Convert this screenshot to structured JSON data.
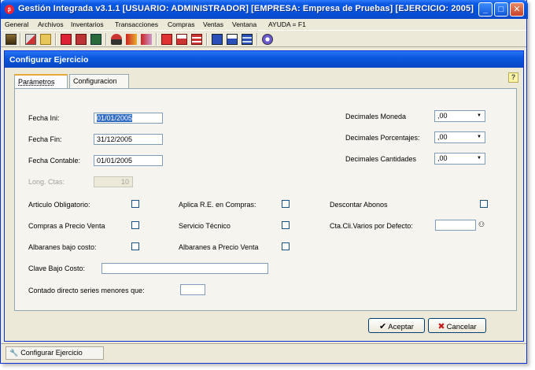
{
  "window": {
    "title": "Gestión Integrada v3.1.1  [USUARIO: ADMINISTRADOR]  [EMPRESA: Empresa de Pruebas]  [EJERCICIO: 2005]",
    "app_icon": "app-logo-icon",
    "min_label": "_",
    "max_label": "□",
    "close_label": "✕"
  },
  "menu": {
    "items": [
      "General",
      "Archivos",
      "Inventarios",
      "Transacciones",
      "Compras",
      "Ventas",
      "Ventana",
      "AYUDA = F1"
    ]
  },
  "toolbar": {
    "icons": [
      "calculator-icon",
      "printer-settings-icon",
      "folder-icon",
      "report-f-icon",
      "report-u-icon",
      "report-b-icon",
      "transfer-icon",
      "payables-icon",
      "receivables-icon",
      "doc-red-icon",
      "doc-open-icon",
      "doc-grid-icon",
      "doc-blue-icon",
      "doc-stack-icon",
      "doc-window-icon",
      "network-icon"
    ]
  },
  "dialog": {
    "title": "Configurar Ejercicio",
    "tabs": [
      "Parámetros",
      "Configuracion"
    ],
    "help_label": "?",
    "fields": {
      "fecha_ini": {
        "label": "Fecha Ini:",
        "value": "01/01/2005"
      },
      "fecha_fin": {
        "label": "Fecha Fin:",
        "value": "31/12/2005"
      },
      "fecha_contable": {
        "label": "Fecha Contable:",
        "value": "01/01/2005"
      },
      "long_ctas": {
        "label": "Long. Ctas:",
        "value": "10"
      },
      "decimales_moneda": {
        "label": "Decimales Moneda",
        "value": ",00"
      },
      "decimales_porcentajes": {
        "label": "Decimales Porcentajes:",
        "value": ",00"
      },
      "decimales_cantidades": {
        "label": "Decimales Cantidades",
        "value": ",00"
      },
      "clave_bajo_costo": {
        "label": "Clave Bajo Costo:",
        "value": ""
      },
      "contado_directo": {
        "label": "Contado directo series menores que:",
        "value": ""
      },
      "cta_cli_varios": {
        "label": "Cta.Cli.Varios por Defecto:",
        "value": ""
      }
    },
    "checkboxes": {
      "articulo_obligatorio": "Articulo Obligatorio:",
      "compras_precio_venta": "Compras a Precio Venta",
      "albaranes_bajo_costo": "Albaranes bajo costo:",
      "aplica_re_compras": "Aplica R.E. en Compras:",
      "servicio_tecnico": "Servicio Técnico",
      "albaranes_precio_venta": "Albaranes a Precio Venta",
      "descontar_abonos": "Descontar Abonos"
    },
    "buttons": {
      "aceptar": "Aceptar",
      "cancelar": "Cancelar"
    }
  },
  "statusbar": {
    "task_label": "Configurar Ejercicio"
  }
}
